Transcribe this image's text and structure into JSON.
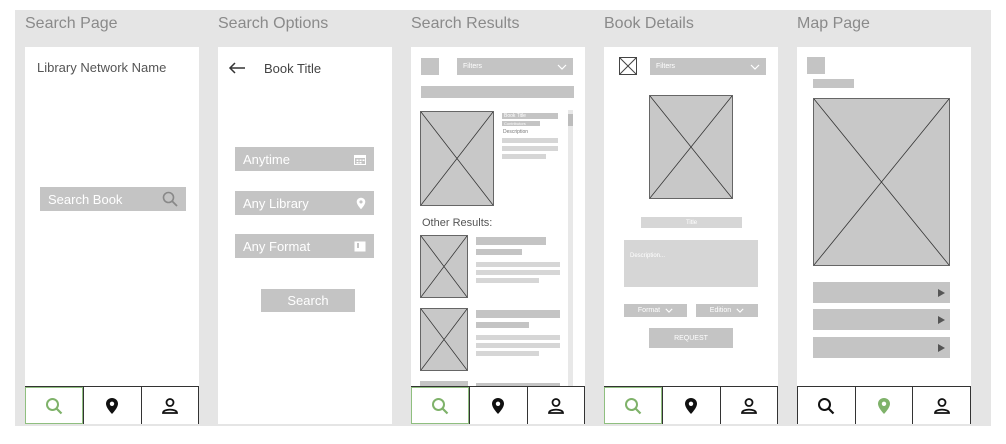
{
  "panels": {
    "p1": {
      "title": "Search Page"
    },
    "p2": {
      "title": "Search Options"
    },
    "p3": {
      "title": "Search Results"
    },
    "p4": {
      "title": "Book Details"
    },
    "p5": {
      "title": "Map Page"
    }
  },
  "search_page": {
    "network_name": "Library Network Name",
    "search_placeholder": "Search Book"
  },
  "search_options": {
    "back_icon": "left-arrow-icon",
    "book_title": "Book Title",
    "time_field": "Anytime",
    "library_field": "Any Library",
    "format_field": "Any Format",
    "search_button": "Search"
  },
  "search_results": {
    "filters": "Filters",
    "top_result": {
      "title": "Book Title",
      "subtitle": "Contributors",
      "description": "Description"
    },
    "other_results_label": "Other Results:"
  },
  "book_details": {
    "filters": "Filters",
    "title": "Title",
    "description": "Description...",
    "format": "Format",
    "edition": "Edition",
    "request": "REQUEST"
  },
  "nav_icons": [
    "search-icon",
    "location-pin-icon",
    "user-icon"
  ],
  "colors": {
    "accent_green": "#7fb26a",
    "placeholder_gray": "#c4c4c4",
    "board_bg": "#e5e5e5"
  }
}
